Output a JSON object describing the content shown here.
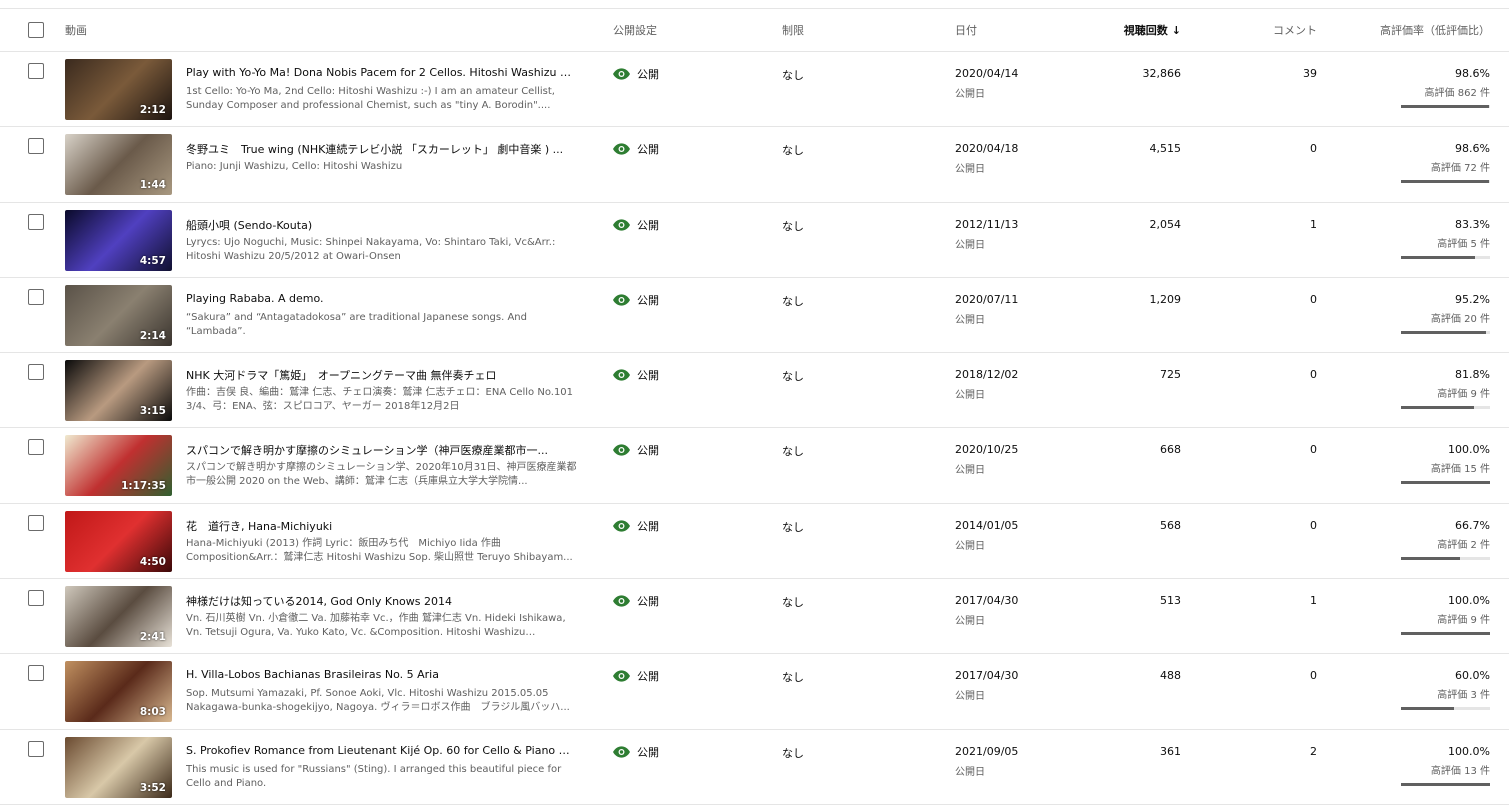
{
  "header": {
    "video": "動画",
    "visibility": "公開設定",
    "restrictions": "制限",
    "date": "日付",
    "views": "視聴回数",
    "sort_icon": "arrow-down-icon",
    "comments": "コメント",
    "likes": "高評価率（低評価比）"
  },
  "colors": {
    "eye_icon": "#2e7d32",
    "like_bar_fill": "#606060",
    "like_bar_track": "#e5e5e5"
  },
  "rows": [
    {
      "duration": "2:12",
      "thumb_colors": [
        "#3a2a1e",
        "#7a5a3a",
        "#1c1410"
      ],
      "title": "Play with Yo-Yo Ma! Dona Nobis Pacem  for 2 Cellos. Hitoshi Washizu #so...",
      "description": "1st Cello: Yo-Yo Ma, 2nd Cello: Hitoshi Washizu :-) I am an amateur Cellist, Sunday Composer and professional Chemist, such as \"tiny A. Borodin\"....",
      "visibility": "公開",
      "restriction": "なし",
      "date": "2020/04/14",
      "date_label": "公開日",
      "views": "32,866",
      "comments": "39",
      "like_pct": "98.6%",
      "like_count": "高評価 862 件",
      "like_ratio": 0.986
    },
    {
      "duration": "1:44",
      "thumb_colors": [
        "#d8d2c8",
        "#6a5a4a",
        "#a89880"
      ],
      "title": "冬野ユミ　True wing (NHK連続テレビ小説 「スカーレット」 劇中音楽 ) ...",
      "description": "Piano: Junji Washizu, Cello: Hitoshi Washizu",
      "visibility": "公開",
      "restriction": "なし",
      "date": "2020/04/18",
      "date_label": "公開日",
      "views": "4,515",
      "comments": "0",
      "like_pct": "98.6%",
      "like_count": "高評価 72 件",
      "like_ratio": 0.986
    },
    {
      "duration": "4:57",
      "thumb_colors": [
        "#0a0a2a",
        "#5040c0",
        "#101030"
      ],
      "title": "船頭小唄 (Sendo-Kouta)",
      "description": "Lyrycs: Ujo Noguchi, Music: Shinpei Nakayama, Vo: Shintaro Taki, Vc&Arr.: Hitoshi Washizu 20/5/2012 at Owari-Onsen",
      "visibility": "公開",
      "restriction": "なし",
      "date": "2012/11/13",
      "date_label": "公開日",
      "views": "2,054",
      "comments": "1",
      "like_pct": "83.3%",
      "like_count": "高評価 5 件",
      "like_ratio": 0.833
    },
    {
      "duration": "2:14",
      "thumb_colors": [
        "#5a5248",
        "#8a8070",
        "#3a342e"
      ],
      "title": "Playing Rababa. A demo.",
      "description": "“Sakura” and “Antagatadokosa” are traditional Japanese songs. And “Lambada”.",
      "visibility": "公開",
      "restriction": "なし",
      "date": "2020/07/11",
      "date_label": "公開日",
      "views": "1,209",
      "comments": "0",
      "like_pct": "95.2%",
      "like_count": "高評価 20 件",
      "like_ratio": 0.952
    },
    {
      "duration": "3:15",
      "thumb_colors": [
        "#0a0a0a",
        "#b89a80",
        "#0a0a0a"
      ],
      "title": "NHK 大河ドラマ「篤姫」　オープニングテーマ曲 無伴奏チェロ",
      "description": "作曲：吉俣 良、編曲：鷲津 仁志、チェロ演奏：鷲津 仁志チェロ：ENA Cello No.101 3/4、弓：ENA、弦：スピロコア、ヤーガー 2018年12月2日",
      "visibility": "公開",
      "restriction": "なし",
      "date": "2018/12/02",
      "date_label": "公開日",
      "views": "725",
      "comments": "0",
      "like_pct": "81.8%",
      "like_count": "高評価 9 件",
      "like_ratio": 0.818
    },
    {
      "duration": "1:17:35",
      "thumb_colors": [
        "#f0ead0",
        "#c03030",
        "#306030"
      ],
      "title": "スパコンで解き明かす摩擦のシミュレーション学（神戸医療産業都市一...",
      "description": "スパコンで解き明かす摩擦のシミュレーション学、2020年10月31日、神戸医療産業都市一般公開 2020 on the Web、講師：鷲津 仁志（兵庫県立大学大学院情...",
      "visibility": "公開",
      "restriction": "なし",
      "date": "2020/10/25",
      "date_label": "公開日",
      "views": "668",
      "comments": "0",
      "like_pct": "100.0%",
      "like_count": "高評価 15 件",
      "like_ratio": 1.0
    },
    {
      "duration": "4:50",
      "thumb_colors": [
        "#c01818",
        "#e03030",
        "#3a0808"
      ],
      "title": "花　道行き, Hana-Michiyuki",
      "description": "Hana-Michiyuki (2013) 作詞 Lyric：飯田みち代　Michiyo Iida 作曲 Composition&Arr.：鷲津仁志 Hitoshi Washizu Sop. 柴山照世 Teruyo Shibayam...",
      "visibility": "公開",
      "restriction": "なし",
      "date": "2014/01/05",
      "date_label": "公開日",
      "views": "568",
      "comments": "0",
      "like_pct": "66.7%",
      "like_count": "高評価 2 件",
      "like_ratio": 0.667
    },
    {
      "duration": "2:41",
      "thumb_colors": [
        "#cfc8bc",
        "#5a4c40",
        "#e8e2d8"
      ],
      "title": "神様だけは知っている2014, God Only Knows 2014",
      "description": "Vn. 石川英樹 Vn. 小倉徹二 Va. 加藤祐幸 Vc.，作曲 鷲津仁志 Vn. Hideki Ishikawa, Vn. Tetsuji Ogura, Va. Yuko Kato, Vc. &Composition. Hitoshi Washizu 2014010...",
      "visibility": "公開",
      "restriction": "なし",
      "date": "2017/04/30",
      "date_label": "公開日",
      "views": "513",
      "comments": "1",
      "like_pct": "100.0%",
      "like_count": "高評価 9 件",
      "like_ratio": 1.0
    },
    {
      "duration": "8:03",
      "thumb_colors": [
        "#c09060",
        "#5a2a1a",
        "#d8b890"
      ],
      "title": "H. Villa-Lobos Bachianas Brasileiras No. 5 Aria",
      "description": "Sop. Mutsumi Yamazaki, Pf. Sonoe Aoki, Vlc. Hitoshi Washizu 2015.05.05 Nakagawa-bunka-shogekijyo, Nagoya. ヴィラ＝ロボス作曲　ブラジル風バッハ...",
      "visibility": "公開",
      "restriction": "なし",
      "date": "2017/04/30",
      "date_label": "公開日",
      "views": "488",
      "comments": "0",
      "like_pct": "60.0%",
      "like_count": "高評価 3 件",
      "like_ratio": 0.6
    },
    {
      "duration": "3:52",
      "thumb_colors": [
        "#6a4a30",
        "#d8c8a8",
        "#3a2818"
      ],
      "title": "S. Prokofiev Romance from Lieutenant Kijé Op. 60 for Cello & Piano #Song...",
      "description": "This music is used for \"Russians\" (Sting). I arranged this beautiful piece for Cello and Piano.",
      "visibility": "公開",
      "restriction": "なし",
      "date": "2021/09/05",
      "date_label": "公開日",
      "views": "361",
      "comments": "2",
      "like_pct": "100.0%",
      "like_count": "高評価 13 件",
      "like_ratio": 1.0
    }
  ]
}
